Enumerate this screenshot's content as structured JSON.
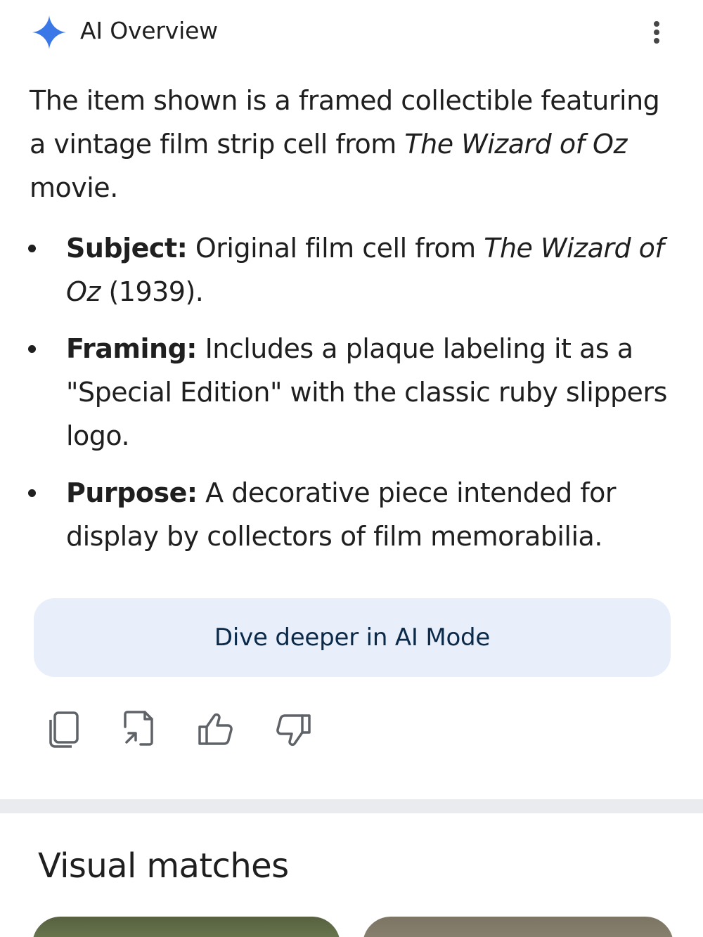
{
  "header": {
    "title": "AI Overview",
    "accent_color": "#3b78e7",
    "menu_icon": "more-vert-icon"
  },
  "intro": {
    "before": "The item shown is a framed collectible featuring a vintage film strip cell from ",
    "italic": "The Wizard of Oz",
    "after": " movie."
  },
  "bullets": [
    {
      "label": "Subject:",
      "before": " Original film cell from ",
      "italic": "The Wizard of Oz",
      "after": " (1939)."
    },
    {
      "label": "Framing:",
      "before": " Includes a plaque labeling it as a \"Special Edition\" with the classic ruby slippers logo.",
      "italic": "",
      "after": ""
    },
    {
      "label": "Purpose:",
      "before": " A decorative piece intended for display by collectors of film memorabilia.",
      "italic": "",
      "after": ""
    }
  ],
  "dive_button": {
    "label": "Dive deeper in AI Mode",
    "bg_color": "#e8effb"
  },
  "actions": [
    {
      "icon": "copy-icon"
    },
    {
      "icon": "share-icon"
    },
    {
      "icon": "thumbs-up-icon"
    },
    {
      "icon": "thumbs-down-icon"
    }
  ],
  "visual_matches": {
    "title": "Visual matches"
  }
}
